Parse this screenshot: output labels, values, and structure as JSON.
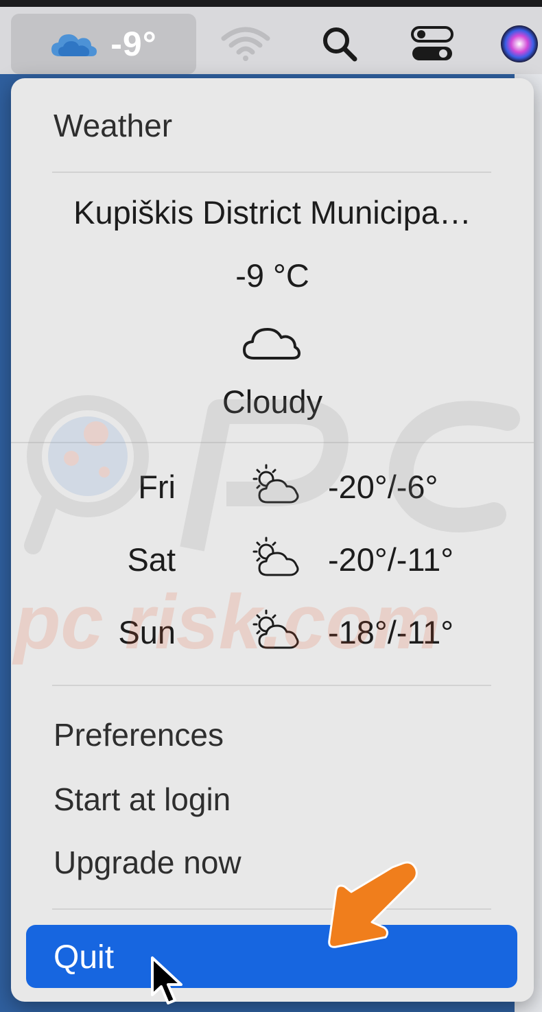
{
  "menubar": {
    "weather_temp": "-9°",
    "icons": [
      "cloud-icon",
      "wifi-icon",
      "search-icon",
      "control-center-icon",
      "siri-icon"
    ]
  },
  "menu": {
    "title": "Weather",
    "location": "Kupiškis District Municipa…",
    "current_temp": "-9 °C",
    "condition_icon": "cloud-icon",
    "condition": "Cloudy",
    "forecast": [
      {
        "day": "Fri",
        "icon": "partly-cloudy-icon",
        "range": "-20°/-6°"
      },
      {
        "day": "Sat",
        "icon": "partly-cloudy-icon",
        "range": "-20°/-11°"
      },
      {
        "day": "Sun",
        "icon": "partly-cloudy-icon",
        "range": "-18°/-11°"
      }
    ],
    "items": [
      "Preferences",
      "Start at login",
      "Upgrade now"
    ],
    "quit_label": "Quit"
  },
  "watermark": "pc risk.com",
  "colors": {
    "highlight": "#1766e0",
    "menu_bg": "#e8e8e8",
    "menubar_bg": "#d9d9dc",
    "annotation_arrow": "#f07e1c",
    "desktop": "#2f5f9e"
  }
}
